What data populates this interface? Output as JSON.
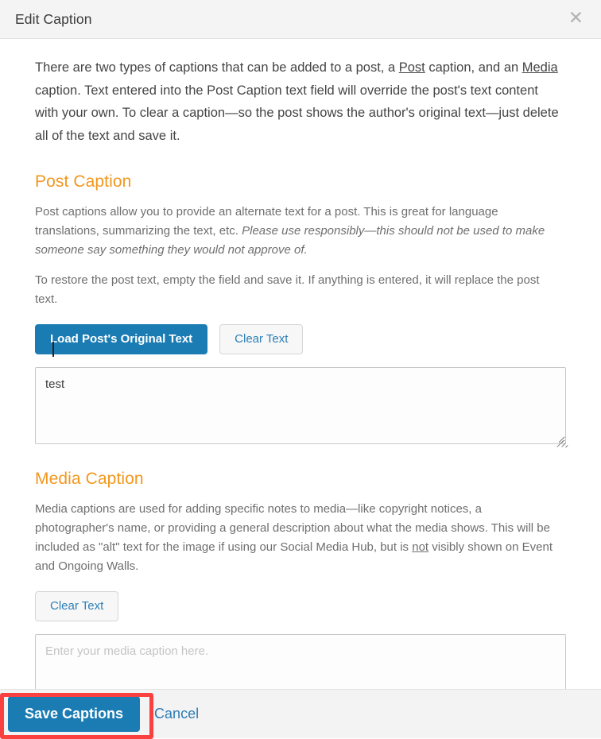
{
  "header": {
    "title": "Edit Caption",
    "close_icon": "close-icon",
    "close_glyph": "✕"
  },
  "intro": {
    "part1": "There are two types of captions that can be added to a post, a ",
    "link1": "Post",
    "part2": " caption, and an ",
    "link2": "Media",
    "part3": " caption. Text entered into the Post Caption text field will override the post's text content with your own. To clear a caption—so the post shows the author's original text—just delete all of the text and save it."
  },
  "post_caption": {
    "heading": "Post Caption",
    "desc_plain": "Post captions allow you to provide an alternate text for a post. This is great for language translations, summarizing the text, etc. ",
    "desc_italic": "Please use responsibly—this should not be used to make someone say something they would not approve of.",
    "restore_note": "To restore the post text, empty the field and save it. If anything is entered, it will replace the post text.",
    "load_button": "Load Post's Original Text",
    "clear_button": "Clear Text",
    "textarea_value": "test",
    "textarea_placeholder": ""
  },
  "media_caption": {
    "heading": "Media Caption",
    "desc_part1": "Media captions are used for adding specific notes to media—like copyright notices, a photographer's name, or providing a general description about what the media shows. This will be included as \"alt\" text for the image if using our Social Media Hub, but is ",
    "desc_underline": "not",
    "desc_part2": " visibly shown on Event and Ongoing Walls.",
    "clear_button": "Clear Text",
    "textarea_value": "",
    "textarea_placeholder": "Enter your media caption here."
  },
  "footer": {
    "save_button": "Save Captions",
    "cancel_link": "Cancel"
  },
  "colors": {
    "accent_blue": "#1b7cb4",
    "heading_orange": "#f2971e",
    "highlight_red": "#fb4040",
    "header_bg": "#f4f4f4",
    "footer_bg": "#f3f3f3"
  }
}
